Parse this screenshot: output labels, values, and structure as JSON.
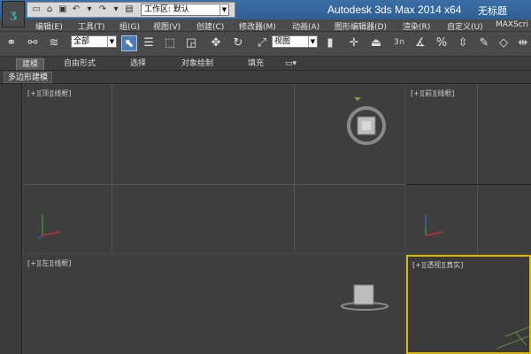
{
  "titlebar": {
    "workspace_label": "工作区: 默认",
    "app_title": "Autodesk 3ds Max  2014 x64",
    "doc_title": "无标题"
  },
  "menu": [
    "编辑(E)",
    "工具(T)",
    "组(G)",
    "视图(V)",
    "创建(C)",
    "修改器(M)",
    "动画(A)",
    "图形编辑器(D)",
    "渲染(R)",
    "自定义(U)",
    "MAXScri"
  ],
  "toolbar": {
    "selection_filter": "全部",
    "ref_coord": "视图",
    "snap_number": "3"
  },
  "ribbon": {
    "tabs": [
      "建模",
      "自由形式",
      "选择",
      "对象绘制",
      "填充"
    ],
    "panel_label": "多边形建模"
  },
  "viewports": {
    "top": "[+][顶][线框]",
    "front": "[+][前][线框]",
    "left": "[+][左][线框]",
    "perspective": "[+][透视][真实]"
  },
  "colors": {
    "title_bar": "#3a6ea5",
    "active_viewport_border": "#d8b800",
    "viewport_bg": "#3e3e3e"
  }
}
